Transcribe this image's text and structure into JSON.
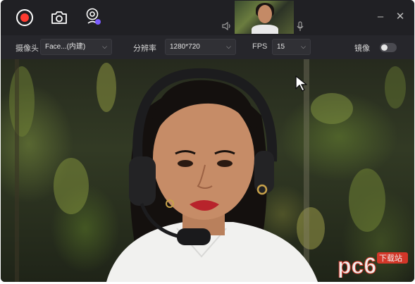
{
  "titlebar": {
    "record_button": "record",
    "screenshot_button": "camera",
    "webcam_button": "webcam",
    "minimize": "–",
    "close": "✕"
  },
  "toolbar": {
    "camera_label": "摄像头",
    "camera_value": "Face...(内建)",
    "resolution_label": "分辨率",
    "resolution_value": "1280*720",
    "fps_label": "FPS",
    "fps_value": "15",
    "mirror_label": "镜像",
    "mirror_on": false
  },
  "watermark": {
    "brand": "pc6",
    "site": "下载站"
  },
  "colors": {
    "record_red": "#ff3b30",
    "titlebar_bg": "#202024",
    "toolbar_bg": "#26262b",
    "watermark_red": "#e1372a"
  },
  "icons": [
    "record-icon",
    "camera-icon",
    "webcam-icon",
    "speaker-icon",
    "microphone-icon",
    "chevron-down-icon",
    "cursor-icon"
  ]
}
